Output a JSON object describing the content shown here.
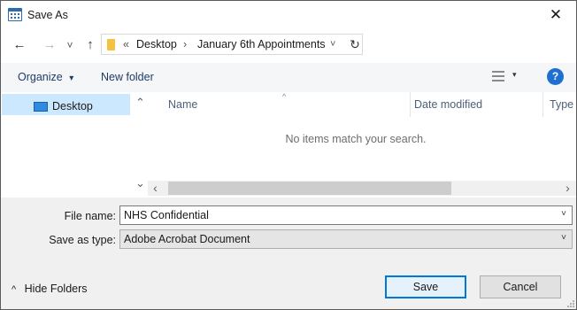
{
  "window": {
    "title": "Save As",
    "close_glyph": "✕"
  },
  "nav": {
    "back_glyph": "←",
    "forward_glyph": "→",
    "recent_glyph": "˅",
    "up_glyph": "↑",
    "breadcrumb": {
      "overflow": "«",
      "items": [
        "Desktop",
        "January 6th Appointments"
      ],
      "separator": "›",
      "dropdown_glyph": "˅"
    },
    "refresh_glyph": "↻"
  },
  "toolbar": {
    "organize_label": "Organize",
    "organize_caret": "▾",
    "new_folder_label": "New folder",
    "view_caret": "▾",
    "help_label": "?"
  },
  "sidebar": {
    "items": [
      {
        "label": "Desktop",
        "icon": "desktop-icon",
        "selected": true
      }
    ],
    "scroll_up": "⌃",
    "scroll_down": "⌄"
  },
  "file_list": {
    "sort_glyph": "^",
    "columns": [
      "Name",
      "Date modified",
      "Type"
    ],
    "empty_message": "No items match your search.",
    "scroll_left": "‹",
    "scroll_right": "›"
  },
  "form": {
    "file_name_label": "File name:",
    "file_name_value": "NHS Confidential",
    "save_type_label": "Save as type:",
    "save_type_value": "Adobe Acrobat Document",
    "dropdown_glyph": "˅"
  },
  "footer": {
    "hide_folders_glyph": "^",
    "hide_folders_label": "Hide Folders",
    "save_label": "Save",
    "cancel_label": "Cancel"
  },
  "colors": {
    "accent": "#0078d7",
    "selection": "#cce8ff",
    "help": "#1f6fd0",
    "folder": "#f4c142"
  }
}
